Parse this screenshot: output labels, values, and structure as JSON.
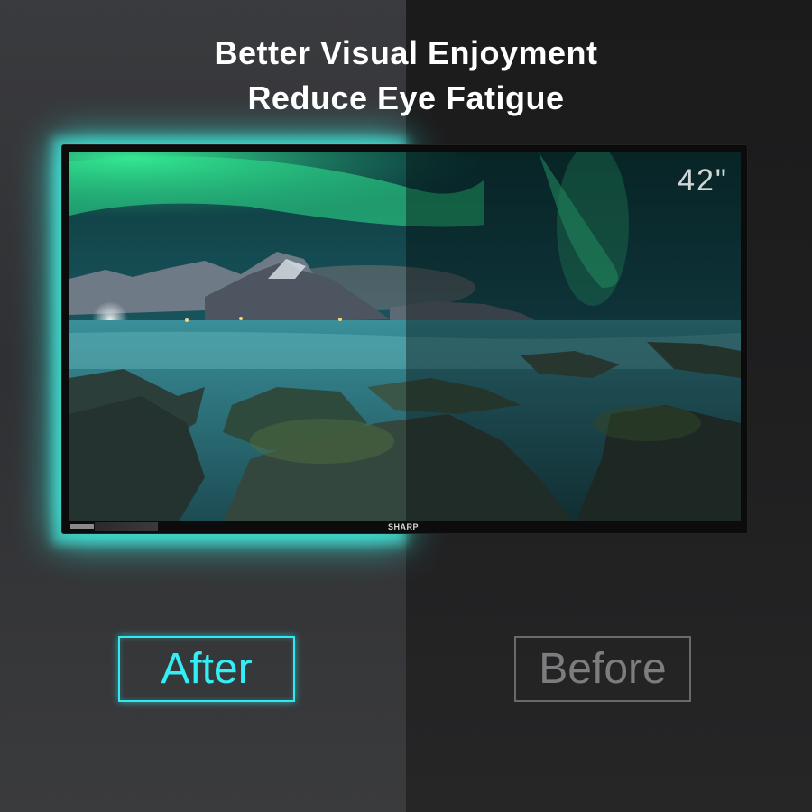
{
  "headline": {
    "line1": "Better Visual Enjoyment",
    "line2": "Reduce Eye Fatigue"
  },
  "tv": {
    "size_label": "42\"",
    "brand": "SHARP"
  },
  "comparison": {
    "after_label": "After",
    "before_label": "Before"
  },
  "colors": {
    "glow": "#3cf0e6",
    "after_accent": "#34eef5",
    "before_accent": "#7d7d7f"
  }
}
